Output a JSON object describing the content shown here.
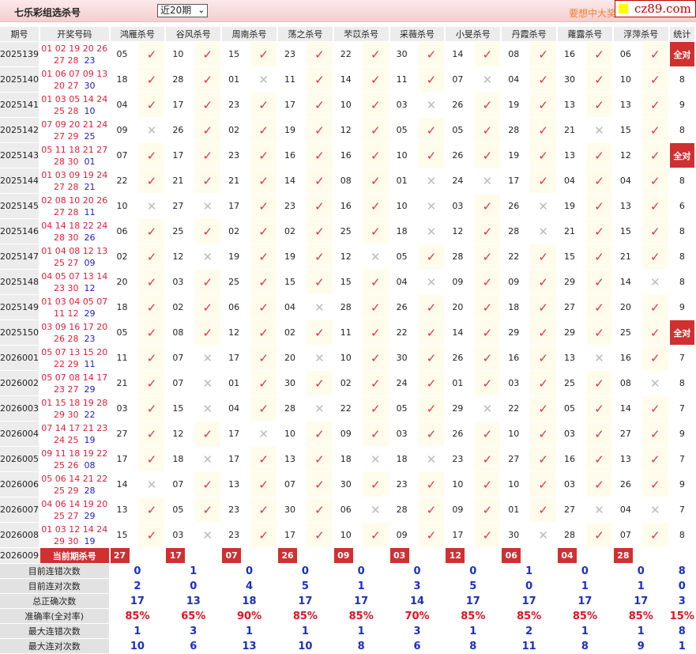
{
  "header": {
    "title": "七乐彩组选杀号",
    "period_select": "近20期",
    "promo": "要想中大奖",
    "logo": "cz89.com"
  },
  "columns": [
    "期号",
    "开奖号码",
    "鸿雁杀号",
    "谷风杀号",
    "周南杀号",
    "荡之杀号",
    "芣苡杀号",
    "采薇杀号",
    "小旻杀号",
    "丹霞杀号",
    "蕹露杀号",
    "浮萍杀号",
    "统计"
  ],
  "rows": [
    {
      "issue": "2025139",
      "red": "01 02 19 20 26 27 28",
      "blue": "23",
      "kills": [
        "05",
        "10",
        "15",
        "23",
        "22",
        "30",
        "14",
        "08",
        "16",
        "06"
      ],
      "hits": "vvvvvvvvvv",
      "stat": "全对"
    },
    {
      "issue": "2025140",
      "red": "01 06 07 09 13 20 27",
      "blue": "30",
      "kills": [
        "18",
        "28",
        "01",
        "11",
        "14",
        "11",
        "07",
        "04",
        "30",
        "10"
      ],
      "hits": "vvxvvvxvvv",
      "stat": "8"
    },
    {
      "issue": "2025141",
      "red": "01 03 05 14 24 25 28",
      "blue": "10",
      "kills": [
        "04",
        "17",
        "23",
        "17",
        "10",
        "03",
        "26",
        "19",
        "13",
        "13"
      ],
      "hits": "vvvvvxvvvv",
      "stat": "9"
    },
    {
      "issue": "2025142",
      "red": "07 09 20 21 24 27 29",
      "blue": "25",
      "kills": [
        "09",
        "26",
        "02",
        "19",
        "12",
        "05",
        "05",
        "28",
        "21",
        "15"
      ],
      "hits": "xvvvvvvvxv",
      "stat": "8"
    },
    {
      "issue": "2025143",
      "red": "05 11 18 21 27 28 30",
      "blue": "01",
      "kills": [
        "07",
        "17",
        "23",
        "16",
        "16",
        "10",
        "26",
        "19",
        "13",
        "12"
      ],
      "hits": "vvvvvvvvvv",
      "stat": "全对"
    },
    {
      "issue": "2025144",
      "red": "01 03 09 19 24 27 28",
      "blue": "21",
      "kills": [
        "22",
        "21",
        "21",
        "14",
        "08",
        "01",
        "24",
        "17",
        "04",
        "04"
      ],
      "hits": "vvvvvxxvvv",
      "stat": "8"
    },
    {
      "issue": "2025145",
      "red": "02 08 10 20 26 27 28",
      "blue": "11",
      "kills": [
        "10",
        "27",
        "17",
        "23",
        "16",
        "10",
        "03",
        "26",
        "19",
        "13"
      ],
      "hits": "xxvvvxvxvv",
      "stat": "6"
    },
    {
      "issue": "2025146",
      "red": "04 14 18 22 24 28 30",
      "blue": "26",
      "kills": [
        "06",
        "25",
        "02",
        "02",
        "25",
        "18",
        "12",
        "28",
        "21",
        "15"
      ],
      "hits": "vvvvvxvxvv",
      "stat": "8"
    },
    {
      "issue": "2025147",
      "red": "01 04 08 12 13 25 27",
      "blue": "09",
      "kills": [
        "02",
        "12",
        "19",
        "19",
        "12",
        "05",
        "28",
        "22",
        "15",
        "21"
      ],
      "hits": "vxvvxvvvvv",
      "stat": "8"
    },
    {
      "issue": "2025148",
      "red": "04 05 07 13 14 23 30",
      "blue": "12",
      "kills": [
        "20",
        "03",
        "25",
        "15",
        "15",
        "04",
        "09",
        "09",
        "29",
        "14"
      ],
      "hits": "vvvvvxvvvx",
      "stat": "8"
    },
    {
      "issue": "2025149",
      "red": "01 03 04 05 07 11 12",
      "blue": "29",
      "kills": [
        "18",
        "02",
        "06",
        "04",
        "28",
        "26",
        "20",
        "18",
        "27",
        "20"
      ],
      "hits": "vvvxvvvvvv",
      "stat": "9"
    },
    {
      "issue": "2025150",
      "red": "03 09 16 17 20 26 28",
      "blue": "23",
      "kills": [
        "05",
        "08",
        "12",
        "02",
        "11",
        "22",
        "14",
        "29",
        "29",
        "25"
      ],
      "hits": "vvvvvvvvvv",
      "stat": "全对"
    },
    {
      "issue": "2026001",
      "red": "05 07 13 15 20 22 29",
      "blue": "11",
      "kills": [
        "11",
        "07",
        "17",
        "20",
        "10",
        "30",
        "26",
        "16",
        "13",
        "16"
      ],
      "hits": "vxvxvvvvxv",
      "stat": "7"
    },
    {
      "issue": "2026002",
      "red": "05 07 08 14 17 23 27",
      "blue": "29",
      "kills": [
        "21",
        "07",
        "01",
        "30",
        "02",
        "24",
        "01",
        "03",
        "25",
        "08"
      ],
      "hits": "vxvvvvvvvx",
      "stat": "8"
    },
    {
      "issue": "2026003",
      "red": "01 15 18 19 28 29 30",
      "blue": "22",
      "kills": [
        "03",
        "15",
        "04",
        "28",
        "22",
        "05",
        "29",
        "22",
        "05",
        "14"
      ],
      "hits": "vxvxvvxvvv",
      "stat": "7"
    },
    {
      "issue": "2026004",
      "red": "07 14 17 21 23 24 25",
      "blue": "19",
      "kills": [
        "27",
        "12",
        "17",
        "10",
        "09",
        "03",
        "26",
        "10",
        "03",
        "27"
      ],
      "hits": "vvxvvvvvvv",
      "stat": "9"
    },
    {
      "issue": "2026005",
      "red": "09 11 18 19 22 25 26",
      "blue": "08",
      "kills": [
        "17",
        "18",
        "17",
        "13",
        "18",
        "18",
        "23",
        "27",
        "16",
        "13"
      ],
      "hits": "vxvvxxvvvv",
      "stat": "7"
    },
    {
      "issue": "2026006",
      "red": "05 06 14 21 22 25 29",
      "blue": "28",
      "kills": [
        "14",
        "07",
        "13",
        "07",
        "30",
        "23",
        "10",
        "10",
        "03",
        "26"
      ],
      "hits": "xvvvvvvvvv",
      "stat": "9"
    },
    {
      "issue": "2026007",
      "red": "04 06 14 19 20 25 27",
      "blue": "29",
      "kills": [
        "13",
        "05",
        "23",
        "30",
        "06",
        "28",
        "09",
        "01",
        "27",
        "04"
      ],
      "hits": "vvvvxvvvxx",
      "stat": "7"
    },
    {
      "issue": "2026008",
      "red": "01 03 12 14 24 29 30",
      "blue": "19",
      "kills": [
        "15",
        "03",
        "23",
        "17",
        "10",
        "09",
        "17",
        "30",
        "28",
        "07"
      ],
      "hits": "vxvvvvvxvv",
      "stat": "8"
    }
  ],
  "current": {
    "issue": "2026009",
    "label": "当前期杀号",
    "kills": [
      "27",
      "17",
      "07",
      "26",
      "09",
      "03",
      "12",
      "06",
      "04",
      "28"
    ]
  },
  "stats": [
    {
      "label": "目前连错次数",
      "values": [
        "0",
        "1",
        "0",
        "0",
        "0",
        "0",
        "0",
        "1",
        "0",
        "0",
        "8"
      ]
    },
    {
      "label": "目前连对次数",
      "values": [
        "2",
        "0",
        "4",
        "5",
        "1",
        "3",
        "5",
        "0",
        "1",
        "1",
        "0"
      ]
    },
    {
      "label": "总正确次数",
      "values": [
        "17",
        "13",
        "18",
        "17",
        "17",
        "14",
        "17",
        "17",
        "17",
        "17",
        "3"
      ]
    },
    {
      "label": "准确率(全对率)",
      "values": [
        "85%",
        "65%",
        "90%",
        "85%",
        "85%",
        "70%",
        "85%",
        "85%",
        "85%",
        "85%",
        "15%"
      ],
      "pct": true
    },
    {
      "label": "最大连错次数",
      "values": [
        "1",
        "3",
        "1",
        "1",
        "1",
        "3",
        "1",
        "2",
        "1",
        "1",
        "8"
      ]
    },
    {
      "label": "最大连对次数",
      "values": [
        "10",
        "6",
        "13",
        "10",
        "8",
        "6",
        "8",
        "11",
        "8",
        "9",
        "1"
      ]
    }
  ],
  "colors": {
    "accent": "#d03030",
    "check": "#e0304a",
    "blue": "#1a2fc0"
  }
}
